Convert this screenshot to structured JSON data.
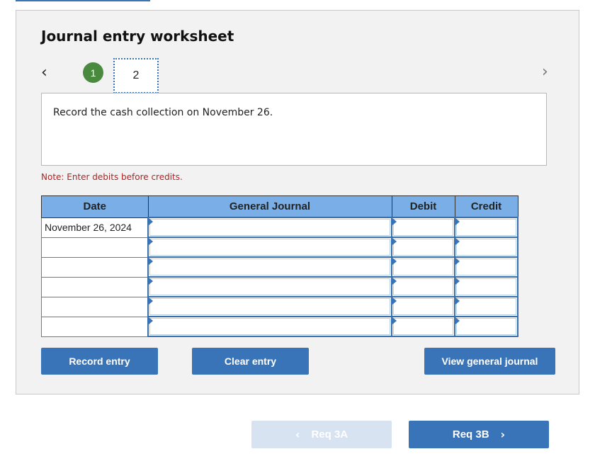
{
  "worksheet": {
    "title": "Journal entry worksheet",
    "nav": {
      "prev_icon": "‹",
      "next_icon": "›"
    },
    "steps": [
      {
        "label": "1",
        "status": "completed"
      },
      {
        "label": "2",
        "status": "current"
      }
    ],
    "prompt": "Record the cash collection on November 26.",
    "note": "Note: Enter debits before credits.",
    "table": {
      "headers": [
        "Date",
        "General Journal",
        "Debit",
        "Credit"
      ],
      "rows": [
        {
          "date": "November 26, 2024",
          "account": "",
          "debit": "",
          "credit": ""
        },
        {
          "date": "",
          "account": "",
          "debit": "",
          "credit": ""
        },
        {
          "date": "",
          "account": "",
          "debit": "",
          "credit": ""
        },
        {
          "date": "",
          "account": "",
          "debit": "",
          "credit": ""
        },
        {
          "date": "",
          "account": "",
          "debit": "",
          "credit": ""
        },
        {
          "date": "",
          "account": "",
          "debit": "",
          "credit": ""
        }
      ]
    },
    "buttons": {
      "record": "Record entry",
      "clear": "Clear entry",
      "view": "View general journal"
    }
  },
  "footer_nav": {
    "prev_label": "Req 3A",
    "prev_icon": "‹",
    "next_label": "Req 3B",
    "next_icon": "›"
  },
  "colors": {
    "accent": "#3a74b8",
    "header_bg": "#7aaee6",
    "completed_step": "#4a8a3f",
    "note": "#b22222",
    "disabled_button": "#d8e3f1"
  }
}
